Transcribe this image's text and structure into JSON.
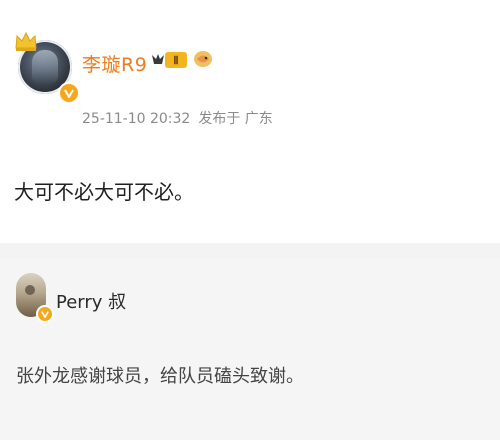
{
  "post": {
    "username": "李璇R9",
    "level_badge": "Ⅱ",
    "timestamp": "25-11-10 20:32",
    "location": "发布于 广东",
    "text": "大可不必大可不必。"
  },
  "comment": {
    "username": "Perry 叔",
    "text": "张外龙感谢球员，给队员磕头致谢。"
  },
  "colors": {
    "username": "#ef7b1a",
    "verified_badge": "#f7a71a",
    "meta_gray": "#8a8a8a",
    "comment_bg": "#f5f5f5"
  }
}
